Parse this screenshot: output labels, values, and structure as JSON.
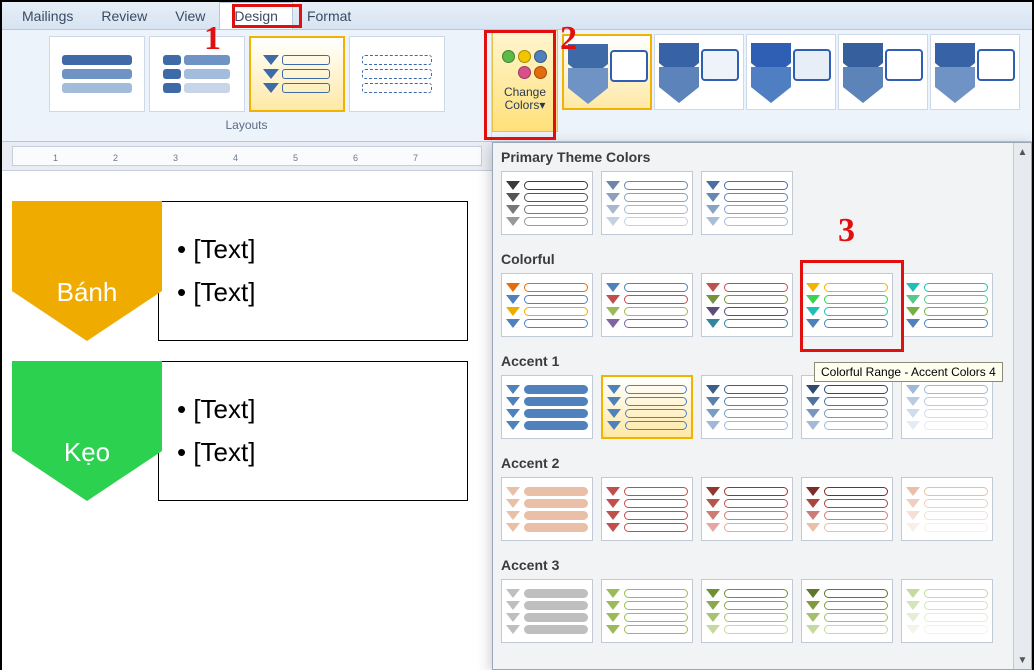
{
  "tabs": [
    "Mailings",
    "Review",
    "View",
    "Design",
    "Format"
  ],
  "active_tab": "Design",
  "ribbon": {
    "layouts_label": "Layouts",
    "change_colors": {
      "line1": "Change",
      "line2": "Colors▾"
    }
  },
  "panel": {
    "sections": [
      {
        "title": "Primary Theme Colors",
        "swatches": [
          {
            "c": [
              "#3b3b3b",
              "#555",
              "#777",
              "#999"
            ]
          },
          {
            "c": [
              "#6f86a8",
              "#8aa0bd",
              "#a7b8ce",
              "#c6d1df"
            ]
          },
          {
            "c": [
              "#4a6fa5",
              "#6787b5",
              "#89a2c6",
              "#abbdd7"
            ]
          }
        ]
      },
      {
        "title": "Colorful",
        "swatches": [
          {
            "c": [
              "#e46c0a",
              "#4f81bd",
              "#f0ab00",
              "#4f81bd"
            ]
          },
          {
            "c": [
              "#4f81bd",
              "#c0504d",
              "#9bbb59",
              "#8064a2"
            ]
          },
          {
            "c": [
              "#c0504d",
              "#76933c",
              "#604a7b",
              "#31859c"
            ]
          },
          {
            "c": [
              "#f0b400",
              "#39d353",
              "#1fbfb8",
              "#4f81bd"
            ]
          },
          {
            "c": [
              "#1fbfb8",
              "#59c98b",
              "#76b043",
              "#4f81bd"
            ]
          }
        ]
      },
      {
        "title": "Accent 1",
        "swatches": [
          {
            "c": [
              "#4f81bd",
              "#4f81bd",
              "#4f81bd",
              "#4f81bd"
            ],
            "fill": true
          },
          {
            "c": [
              "#4f81bd",
              "#4f81bd",
              "#4f81bd",
              "#4f81bd"
            ],
            "sel": true
          },
          {
            "c": [
              "#3b5e8c",
              "#5b80b0",
              "#7b9cc3",
              "#9db9d7"
            ]
          },
          {
            "c": [
              "#2f4a6f",
              "#53729b",
              "#7a96bd",
              "#a4b9d6"
            ]
          },
          {
            "c": [
              "#9db9d7",
              "#b7cbe3",
              "#cfdced",
              "#e4ebf4"
            ]
          }
        ]
      },
      {
        "title": "Accent 2",
        "swatches": [
          {
            "c": [
              "#e9bfa8",
              "#e9bfa8",
              "#e9bfa8",
              "#e9bfa8"
            ],
            "fill": true
          },
          {
            "c": [
              "#c0504d",
              "#c0504d",
              "#c0504d",
              "#c0504d"
            ]
          },
          {
            "c": [
              "#95352f",
              "#b4554f",
              "#cf7b75",
              "#e4a7a2"
            ]
          },
          {
            "c": [
              "#7e2c27",
              "#a9473f",
              "#cf7b75",
              "#e9bfa8"
            ]
          },
          {
            "c": [
              "#e9bfa8",
              "#efcfbf",
              "#f4e0d5",
              "#f9efe9"
            ]
          }
        ]
      },
      {
        "title": "Accent 3",
        "swatches": [
          {
            "c": [
              "#bfbfbf",
              "#bfbfbf",
              "#bfbfbf",
              "#bfbfbf"
            ],
            "fill": true
          },
          {
            "c": [
              "#9bbb59",
              "#9bbb59",
              "#9bbb59",
              "#9bbb59"
            ]
          },
          {
            "c": [
              "#6f8f37",
              "#8aa94f",
              "#a8c274",
              "#c6da9f"
            ]
          },
          {
            "c": [
              "#5d772c",
              "#7e9b43",
              "#a3bf6b",
              "#c6da9f"
            ]
          },
          {
            "c": [
              "#c6da9f",
              "#d6e4bb",
              "#e5eed4",
              "#f2f6e9"
            ]
          }
        ]
      }
    ]
  },
  "tooltip": "Colorful Range - Accent Colors 4",
  "smartart": {
    "rows": [
      {
        "label": "Bánh",
        "color": "#f0ab00",
        "bullets": [
          "[Text]",
          "[Text]"
        ]
      },
      {
        "label": "Kẹo",
        "color": "#2bd14f",
        "bullets": [
          "[Text]",
          "[Text]"
        ]
      }
    ]
  },
  "ruler_marks": [
    "1",
    "2",
    "3",
    "4",
    "5",
    "6",
    "7"
  ],
  "annotations": {
    "n1": "1",
    "n2": "2",
    "n3": "3"
  }
}
